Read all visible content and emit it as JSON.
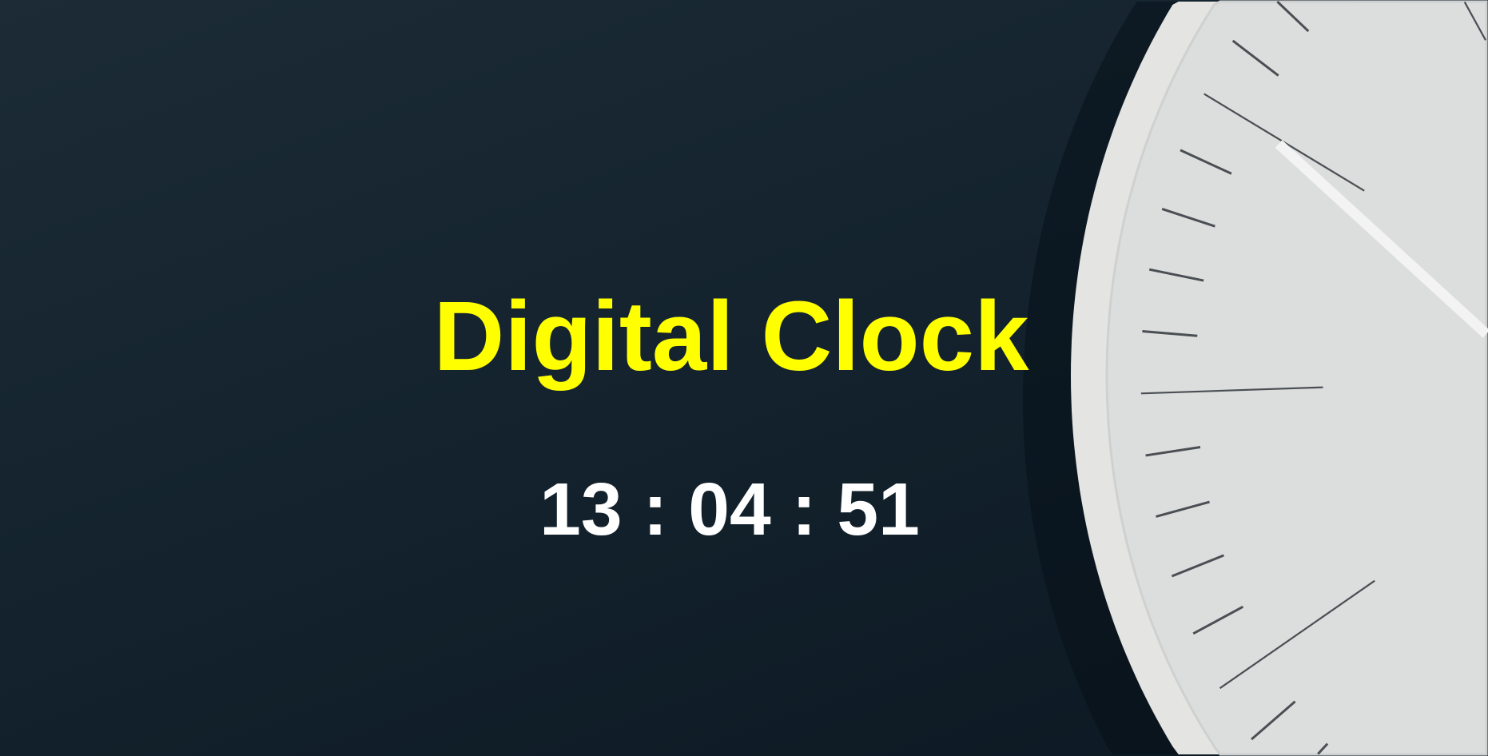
{
  "header": {
    "title": "Digital Clock"
  },
  "clock": {
    "hours": "13",
    "minutes": "04",
    "seconds": "51",
    "separator": ":"
  },
  "colors": {
    "title": "#ffff00",
    "time": "#ffffff",
    "background": "#14232e",
    "clock_face": "#dcdedd"
  },
  "background_image": "analog-wall-clock-icon"
}
